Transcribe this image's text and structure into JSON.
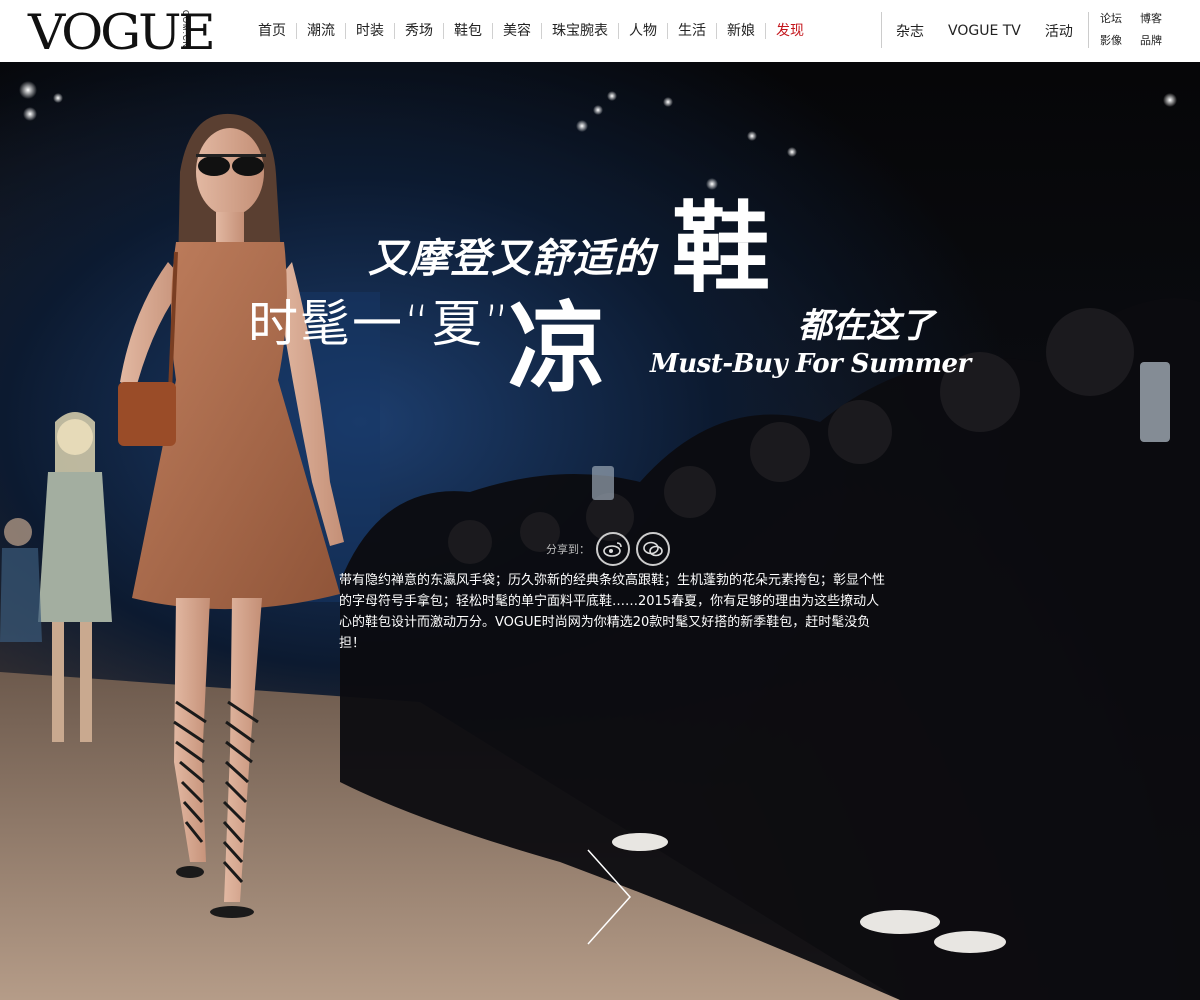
{
  "header": {
    "logo_text": "VOGUE",
    "logo_sub": "COM.CN",
    "nav": [
      "首页",
      "潮流",
      "时装",
      "秀场",
      "鞋包",
      "美容",
      "珠宝腕表",
      "人物",
      "生活",
      "新娘",
      "发现"
    ],
    "nav_highlight_index": 10,
    "nav_secondary": [
      "杂志",
      "VOGUE TV",
      "活动"
    ],
    "nav_small": [
      "论坛",
      "博客",
      "影像",
      "品牌"
    ]
  },
  "hero": {
    "headline_line1": "又摩登又舒适的",
    "headline_big1": "鞋",
    "headline_line2": "时髦一“夏”",
    "headline_big2": "凉",
    "headline_line3": "都在这了",
    "headline_en": "Must-Buy For Summer",
    "share_label": "分享到：",
    "share_icons": [
      "weibo-icon",
      "wechat-icon"
    ],
    "intro": "带有隐约禅意的东瀛风手袋；历久弥新的经典条纹高跟鞋；生机蓬勃的花朵元素挎包；彰显个性的字母符号手拿包；轻松时髦的单宁面料平底鞋……2015春夏，你有足够的理由为这些撩动人心的鞋包设计而激动万分。VOGUE时尚网为你精选20款时髦又好搭的新季鞋包，赶时髦没负担！"
  },
  "colors": {
    "accent_red": "#c4161c",
    "header_bg": "#ffffff",
    "hero_text": "#ffffff"
  }
}
